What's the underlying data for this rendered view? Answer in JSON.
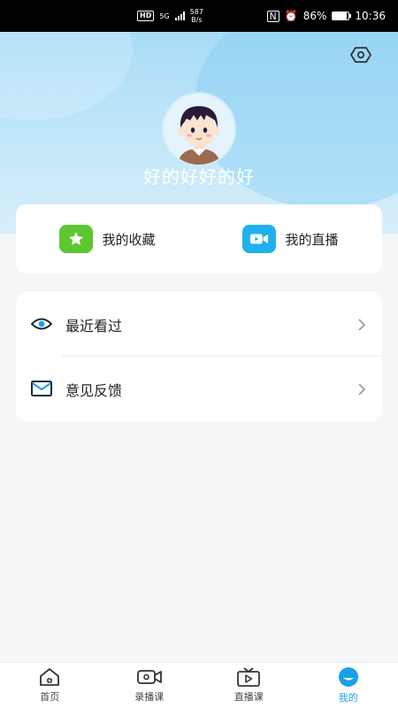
{
  "status_bar": {
    "network_badge": "HD",
    "signal_label": "5G",
    "speed_value": "587",
    "speed_unit": "B/s",
    "battery": "86%",
    "time": "10:36"
  },
  "header": {
    "username": "好的好好的好",
    "settings_icon": "settings-hexagon-icon"
  },
  "quick_actions": [
    {
      "label": "我的收藏",
      "icon": "star-icon",
      "color": "#5cc72f"
    },
    {
      "label": "我的直播",
      "icon": "video-camera-icon",
      "color": "#1fb0ee"
    }
  ],
  "menu": [
    {
      "label": "最近看过",
      "icon": "eye-icon"
    },
    {
      "label": "意见反馈",
      "icon": "mail-icon"
    }
  ],
  "bottom_nav": [
    {
      "label": "首页",
      "icon": "home-icon",
      "active": false
    },
    {
      "label": "录播课",
      "icon": "video-record-icon",
      "active": false
    },
    {
      "label": "直播课",
      "icon": "tv-play-icon",
      "active": false
    },
    {
      "label": "我的",
      "icon": "profile-icon",
      "active": true
    }
  ],
  "colors": {
    "accent": "#1aa0e8",
    "header_top": "#a9dcf6",
    "page_bg": "#f5f6f8"
  }
}
